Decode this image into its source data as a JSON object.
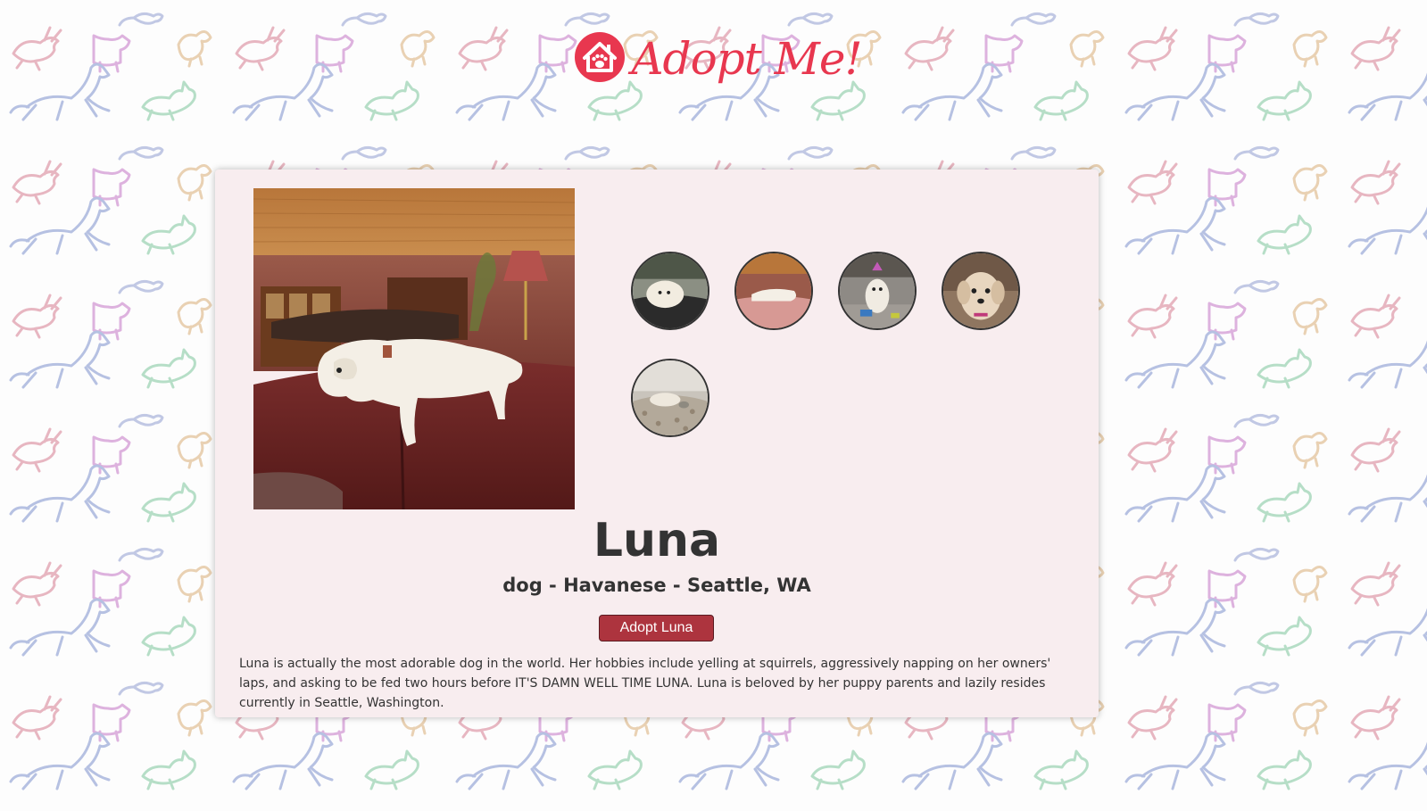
{
  "site": {
    "logo_text": "Adopt Me!",
    "logo_icon": "house-paw-icon",
    "brand_color": "#e8374f"
  },
  "pet": {
    "name": "Luna",
    "subtitle": "dog - Havanese - Seattle, WA",
    "adopt_label": "Adopt Luna",
    "description": "Luna is actually the most adorable dog in the world. Her hobbies include yelling at squirrels, aggressively napping on her owners' laps, and asking to be fed two hours before IT'S DAMN WELL TIME LUNA. Luna is beloved by her puppy parents and lazily resides currently in Seattle, Washington."
  },
  "colors": {
    "card_background": "#f8edef",
    "button_background": "#ad343e",
    "text": "#333333"
  }
}
